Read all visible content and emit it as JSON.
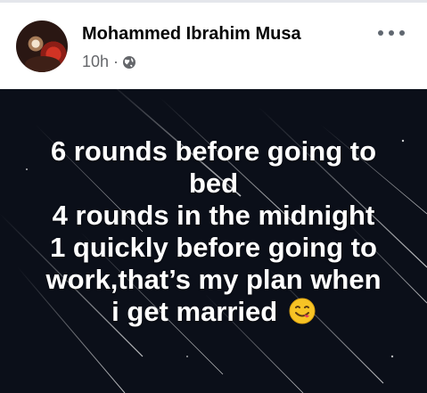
{
  "post": {
    "author_name": "Mohammed Ibrahim Musa",
    "timestamp": "10h",
    "separator": "·",
    "privacy_icon": "globe-icon",
    "more_icon": "more-options-icon",
    "text_lines": [
      "6 rounds before going to",
      "bed",
      "4 rounds in the midnight",
      "1 quickly before going to",
      "work,that’s my plan when",
      "i get married"
    ],
    "emoji": "face-savoring-food-emoji"
  },
  "colors": {
    "background_dark": "#0b0f19",
    "text_on_dark": "#ffffff",
    "meta_text": "#65676b",
    "name_text": "#050505"
  }
}
